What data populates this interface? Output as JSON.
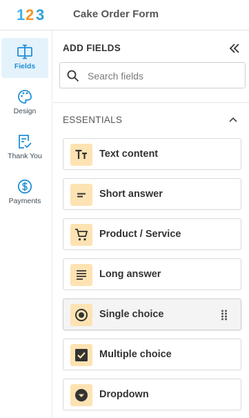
{
  "header": {
    "logo_text": "123",
    "title": "Cake Order Form"
  },
  "rail": {
    "items": [
      {
        "label": "Fields",
        "icon": "fields-icon",
        "active": true
      },
      {
        "label": "Design",
        "icon": "palette-icon",
        "active": false
      },
      {
        "label": "Thank You",
        "icon": "thank-you-icon",
        "active": false
      },
      {
        "label": "Payments",
        "icon": "dollar-icon",
        "active": false
      }
    ]
  },
  "panel": {
    "title": "ADD FIELDS",
    "search": {
      "placeholder": "Search fields",
      "value": ""
    },
    "section": {
      "title": "ESSENTIALS",
      "expanded": true
    },
    "fields": [
      {
        "label": "Text content",
        "icon": "text-content-icon"
      },
      {
        "label": "Short answer",
        "icon": "short-answer-icon"
      },
      {
        "label": "Product / Service",
        "icon": "cart-icon"
      },
      {
        "label": "Long answer",
        "icon": "long-answer-icon"
      },
      {
        "label": "Single choice",
        "icon": "radio-icon",
        "hovered": true
      },
      {
        "label": "Multiple choice",
        "icon": "checkbox-icon"
      },
      {
        "label": "Dropdown",
        "icon": "dropdown-icon"
      }
    ]
  },
  "colors": {
    "accent": "#1e8fd6",
    "active_rail_bg": "#e4f2fb",
    "field_icon_bg": "#fde3b3",
    "logo_1": "#3fb0e8",
    "logo_2": "#f7941d",
    "logo_3": "#2f9fd8"
  }
}
